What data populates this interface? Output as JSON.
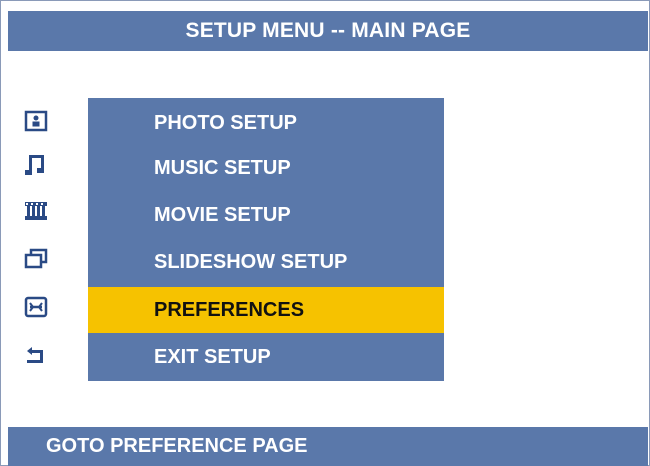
{
  "header": {
    "title": "SETUP MENU -- MAIN PAGE"
  },
  "menu": {
    "items": [
      {
        "label": "PHOTO SETUP",
        "icon": "photo-icon",
        "selected": false
      },
      {
        "label": "MUSIC SETUP",
        "icon": "music-note-icon",
        "selected": false
      },
      {
        "label": "MOVIE SETUP",
        "icon": "film-strip-icon",
        "selected": false
      },
      {
        "label": "SLIDESHOW SETUP",
        "icon": "slideshow-icon",
        "selected": false
      },
      {
        "label": "PREFERENCES",
        "icon": "preferences-icon",
        "selected": true
      },
      {
        "label": "EXIT SETUP",
        "icon": "exit-arrow-icon",
        "selected": false
      }
    ]
  },
  "status": {
    "hint": "GOTO PREFERENCE PAGE"
  },
  "colors": {
    "bar_blue": "#5a78aa",
    "highlight_yellow": "#f6c200",
    "icon_blue": "#2a4a85"
  }
}
